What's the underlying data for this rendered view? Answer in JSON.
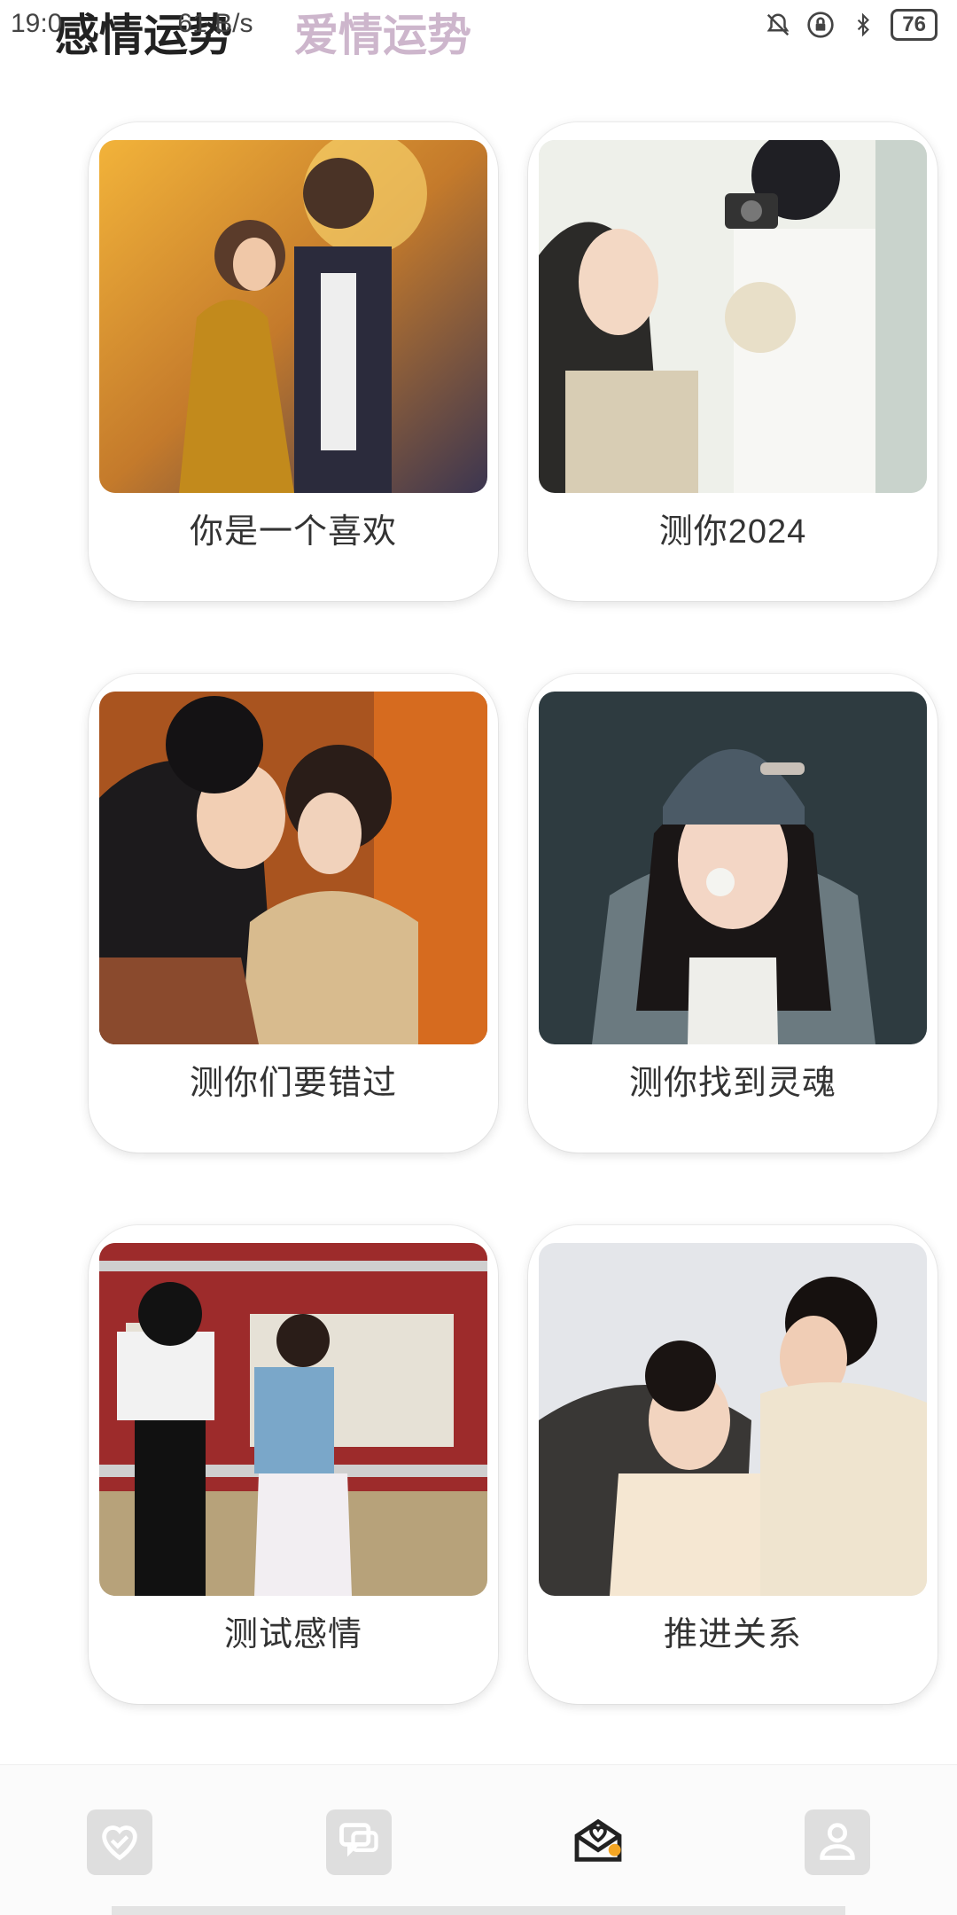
{
  "status_bar": {
    "time": "19:0",
    "network_speed": "61 B/s",
    "battery": "76",
    "icons": [
      "alarm-off-icon",
      "vpn-lock-icon",
      "bluetooth-icon"
    ]
  },
  "header": {
    "tabs": [
      {
        "label": "感情运势",
        "active": true
      },
      {
        "label": "爱情运势",
        "active": false
      }
    ]
  },
  "cards": [
    {
      "label": "你是一个喜欢",
      "image": "autumn-couple-illustration"
    },
    {
      "label": "测你2024",
      "image": "couple-camera-flowers-photo"
    },
    {
      "label": "测你们要错过",
      "image": "couple-embrace-photo"
    },
    {
      "label": "测你找到灵魂",
      "image": "girl-beanie-bubblegum-photo"
    },
    {
      "label": "测试感情",
      "image": "couple-standing-street-photo"
    },
    {
      "label": "推进关系",
      "image": "couple-windblown-sky-photo"
    }
  ],
  "bottom_nav": {
    "items": [
      {
        "icon": "heart-icon",
        "active": false
      },
      {
        "icon": "chat-icon",
        "active": false
      },
      {
        "icon": "love-letter-icon",
        "active": true
      },
      {
        "icon": "profile-icon",
        "active": false
      }
    ]
  },
  "colors": {
    "active_tab": "#222222",
    "inactive_tab": "#cdb6cc",
    "accent_dot": "#f5a623"
  }
}
